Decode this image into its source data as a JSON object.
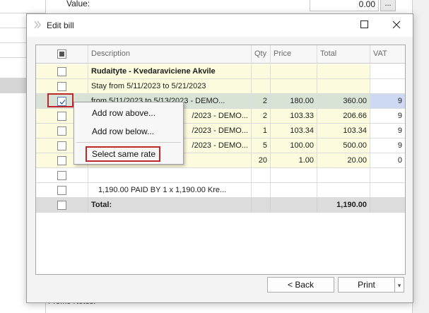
{
  "background": {
    "value_label": "Value:",
    "value_field": "0.00",
    "value_button": "...",
    "promo_notes_label": "Promo Notes:"
  },
  "dialog": {
    "title": "Edit bill",
    "icons": {
      "app": "app-icon",
      "maximize": "maximize-icon",
      "close": "close-icon"
    }
  },
  "grid": {
    "columns": [
      "Description",
      "Qty",
      "Price",
      "Total",
      "VAT"
    ],
    "rows": [
      {
        "description": "Rudaityte - Kvedaraviciene Akvile",
        "qty": "",
        "price": "",
        "total": "",
        "vat": ""
      },
      {
        "description": "Stay from 5/11/2023 to 5/21/2023",
        "qty": "",
        "price": "",
        "total": "",
        "vat": ""
      },
      {
        "description": "from 5/11/2023 to 5/13/2023 - DEMO...",
        "qty": "2",
        "price": "180.00",
        "total": "360.00",
        "vat": "9"
      },
      {
        "description": "/2023 - DEMO...",
        "qty": "2",
        "price": "103.33",
        "total": "206.66",
        "vat": "9"
      },
      {
        "description": "/2023 - DEMO...",
        "qty": "1",
        "price": "103.34",
        "total": "103.34",
        "vat": "9"
      },
      {
        "description": "/2023 - DEMO...",
        "qty": "5",
        "price": "100.00",
        "total": "500.00",
        "vat": "9"
      },
      {
        "description": "",
        "qty": "20",
        "price": "1.00",
        "total": "20.00",
        "vat": "0"
      },
      {
        "description": "",
        "qty": "",
        "price": "",
        "total": "",
        "vat": ""
      },
      {
        "description": "1,190.00 PAID BY  1 x   1,190.00 Kre...",
        "qty": "",
        "price": "",
        "total": "",
        "vat": ""
      }
    ],
    "total_row": {
      "label": "Total:",
      "total": "1,190.00"
    }
  },
  "context_menu": {
    "add_above": "Add row above...",
    "add_below": "Add row below...",
    "select_same_rate": "Select same rate"
  },
  "footer": {
    "back": "< Back",
    "print": "Print",
    "dropdown": "▾"
  }
}
